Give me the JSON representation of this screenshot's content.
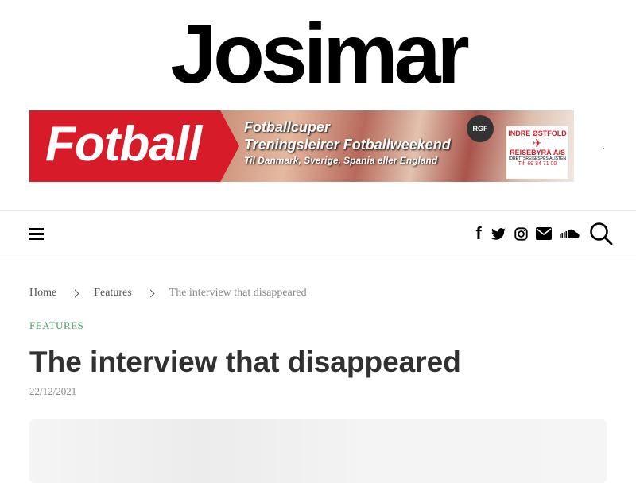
{
  "site": {
    "logo_text": "Josimar"
  },
  "banner": {
    "headline": "Fotball",
    "line1": "Fotballcuper",
    "line2": "Treningsleirer  Fotballweekend",
    "line3": "Til Danmark, Sverige, Spania eller England",
    "seal_text": "RGF",
    "agency_top": "INDRE ØSTFOLD",
    "agency_name": "REISEBYRÅ A/S",
    "agency_sub": "IDRETTSREISESPESIALISTEN",
    "agency_phone": "Tlf: 69 84 71 00"
  },
  "nav": {
    "menu_icon": "hamburger-icon",
    "social": [
      "facebook-icon",
      "twitter-icon",
      "instagram-icon",
      "envelope-icon",
      "soundcloud-icon"
    ],
    "search_icon": "search-icon"
  },
  "breadcrumb": {
    "items": [
      "Home",
      "Features",
      "The interview that disappeared"
    ]
  },
  "article": {
    "category": "FEATURES",
    "title": "The interview that disappeared",
    "date": "22/12/2021"
  }
}
